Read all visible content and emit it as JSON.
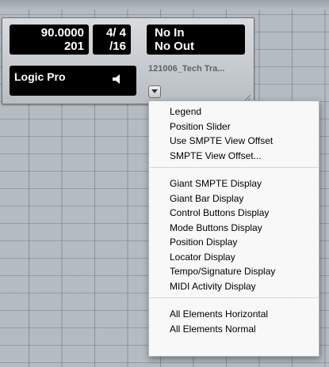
{
  "transport": {
    "position_line1": "90.0000",
    "position_line2": "201",
    "signature_line1": "4/ 4",
    "signature_line2": "/16",
    "midi_in": "No In",
    "midi_out": "No Out",
    "app_name": "Logic Pro",
    "project_name": "121006_Tech Tra...",
    "speaker_icon": "speaker-icon",
    "dropdown_icon": "chevron-down-icon"
  },
  "menu": {
    "groups": [
      [
        "Legend",
        "Position Slider",
        "Use SMPTE View Offset",
        "SMPTE View Offset..."
      ],
      [
        "Giant SMPTE Display",
        "Giant Bar Display",
        "Control Buttons Display",
        "Mode Buttons Display",
        "Position Display",
        "Locator Display",
        "Tempo/Signature Display",
        "MIDI Activity Display"
      ],
      [
        "All Elements Horizontal",
        "All Elements Normal"
      ]
    ]
  }
}
